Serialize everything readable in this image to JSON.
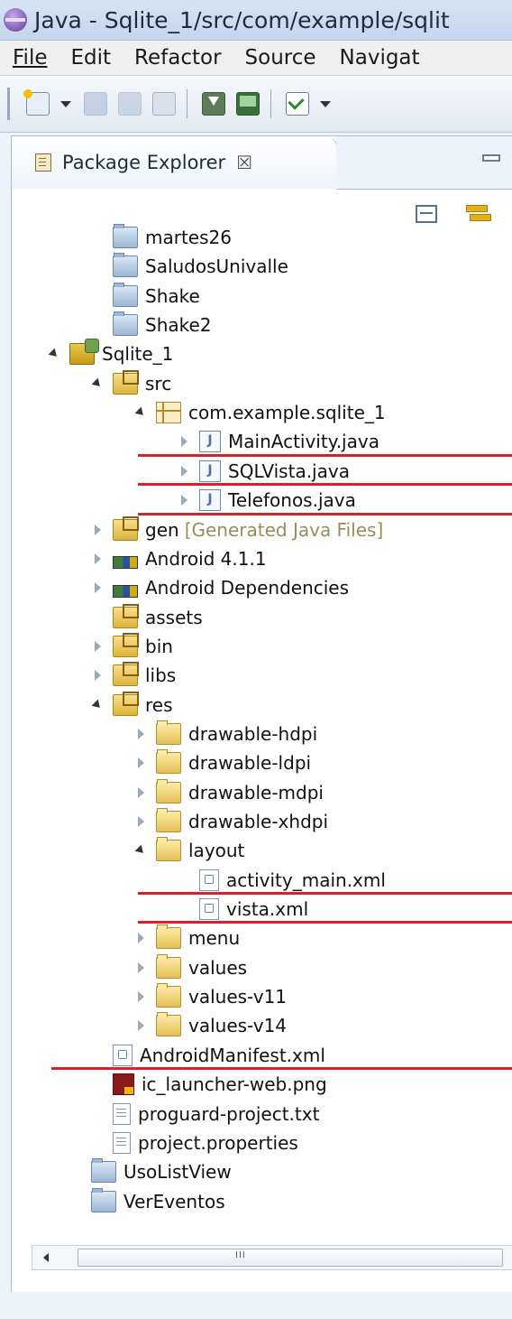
{
  "window": {
    "title": "Java - Sqlite_1/src/com/example/sqlit"
  },
  "menu": {
    "items": [
      "File",
      "Edit",
      "Refactor",
      "Source",
      "Navigat"
    ]
  },
  "toolbar": {
    "icons": [
      "new-icon",
      "save-icon",
      "save-all-icon",
      "print-icon",
      "download-icon",
      "image-icon",
      "check-icon"
    ]
  },
  "view": {
    "title": "Package Explorer",
    "close": "☒"
  },
  "tree": {
    "nodes": [
      {
        "label": "martes26",
        "depth": 1,
        "icon": "project",
        "twisty": "none"
      },
      {
        "label": "SaludosUnivalle",
        "depth": 1,
        "icon": "project",
        "twisty": "none"
      },
      {
        "label": "Shake",
        "depth": 1,
        "icon": "project",
        "twisty": "none"
      },
      {
        "label": "Shake2",
        "depth": 1,
        "icon": "project",
        "twisty": "none"
      },
      {
        "label": "Sqlite_1",
        "depth": 0,
        "icon": "android-proj",
        "twisty": "open"
      },
      {
        "label": "src",
        "depth": 1,
        "icon": "srcfolder",
        "twisty": "open"
      },
      {
        "label": "com.example.sqlite_1",
        "depth": 2,
        "icon": "package",
        "twisty": "open"
      },
      {
        "label": "MainActivity.java",
        "depth": 3,
        "icon": "java",
        "twisty": "closed",
        "underline": true
      },
      {
        "label": "SQLVista.java",
        "depth": 3,
        "icon": "java",
        "twisty": "closed",
        "underline": true
      },
      {
        "label": "Telefonos.java",
        "depth": 3,
        "icon": "java",
        "twisty": "closed",
        "underline": true
      },
      {
        "label": "gen",
        "depth": 1,
        "icon": "srcfolder",
        "twisty": "closed",
        "decor": "[Generated Java Files]"
      },
      {
        "label": "Android 4.1.1",
        "depth": 1,
        "icon": "lib",
        "twisty": "closed"
      },
      {
        "label": "Android Dependencies",
        "depth": 1,
        "icon": "lib",
        "twisty": "closed"
      },
      {
        "label": "assets",
        "depth": 1,
        "icon": "srcfolder",
        "twisty": "none"
      },
      {
        "label": "bin",
        "depth": 1,
        "icon": "srcfolder",
        "twisty": "closed"
      },
      {
        "label": "libs",
        "depth": 1,
        "icon": "srcfolder",
        "twisty": "closed"
      },
      {
        "label": "res",
        "depth": 1,
        "icon": "srcfolder",
        "twisty": "open"
      },
      {
        "label": "drawable-hdpi",
        "depth": 2,
        "icon": "folder",
        "twisty": "closed"
      },
      {
        "label": "drawable-ldpi",
        "depth": 2,
        "icon": "folder",
        "twisty": "closed"
      },
      {
        "label": "drawable-mdpi",
        "depth": 2,
        "icon": "folder",
        "twisty": "closed"
      },
      {
        "label": "drawable-xhdpi",
        "depth": 2,
        "icon": "folder",
        "twisty": "closed"
      },
      {
        "label": "layout",
        "depth": 2,
        "icon": "folder",
        "twisty": "open"
      },
      {
        "label": "activity_main.xml",
        "depth": 3,
        "icon": "xml",
        "twisty": "none",
        "underline": true
      },
      {
        "label": "vista.xml",
        "depth": 3,
        "icon": "xml",
        "twisty": "none",
        "underline": true
      },
      {
        "label": "menu",
        "depth": 2,
        "icon": "folder",
        "twisty": "closed"
      },
      {
        "label": "values",
        "depth": 2,
        "icon": "folder",
        "twisty": "closed"
      },
      {
        "label": "values-v11",
        "depth": 2,
        "icon": "folder",
        "twisty": "closed"
      },
      {
        "label": "values-v14",
        "depth": 2,
        "icon": "folder",
        "twisty": "closed"
      },
      {
        "label": "AndroidManifest.xml",
        "depth": 1,
        "icon": "xml",
        "twisty": "none",
        "underline": true
      },
      {
        "label": "ic_launcher-web.png",
        "depth": 1,
        "icon": "png",
        "twisty": "none"
      },
      {
        "label": "proguard-project.txt",
        "depth": 1,
        "icon": "txt",
        "twisty": "none"
      },
      {
        "label": "project.properties",
        "depth": 1,
        "icon": "txt",
        "twisty": "none"
      },
      {
        "label": "UsoListView",
        "depth": 0.5,
        "icon": "project",
        "twisty": "none"
      },
      {
        "label": "VerEventos",
        "depth": 0.5,
        "icon": "project",
        "twisty": "none"
      }
    ]
  },
  "colors": {
    "underline": "#d8212b",
    "decor": "#9c8c5a"
  }
}
